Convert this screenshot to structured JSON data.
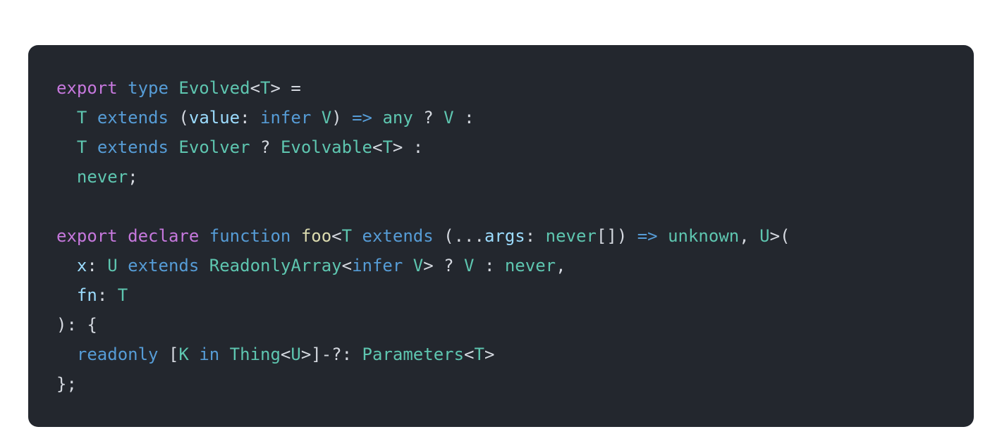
{
  "colors": {
    "background": "#23272e",
    "keyword_export": "#c678dd",
    "keyword_storage": "#c678dd",
    "keyword_type": "#569cd6",
    "type_name": "#5ec6b0",
    "param_name": "#9cdcfe",
    "fn_name": "#dcdcb0",
    "default_text": "#d5d9e0"
  },
  "code": {
    "l0": {
      "export": "export",
      "type": "type",
      "Evolved": "Evolved",
      "lt": "<",
      "T": "T",
      "gt": ">",
      "eq": " ="
    },
    "l1": {
      "indent": "  ",
      "T": "T",
      "extends": "extends",
      "paren_open": "(",
      "value": "value",
      "colon": ":",
      "infer": "infer",
      "V": "V",
      "paren_close": ")",
      "arrow": "=>",
      "any": "any",
      "q": "?",
      "V2": "V",
      "colon2": ":"
    },
    "l2": {
      "indent": "  ",
      "T": "T",
      "extends": "extends",
      "Evolver": "Evolver",
      "q": "?",
      "Evolvable": "Evolvable",
      "lt": "<",
      "T2": "T",
      "gt": ">",
      "colon": ":"
    },
    "l3": {
      "indent": "  ",
      "never": "never",
      "semi": ";"
    },
    "l5": {
      "export": "export",
      "declare": "declare",
      "function": "function",
      "foo": "foo",
      "lt": "<",
      "T": "T",
      "extends": "extends",
      "paren_open": "(",
      "ellipsis": "...",
      "args": "args",
      "colon": ":",
      "never": "never",
      "brackets": "[]",
      "paren_close": ")",
      "arrow": "=>",
      "unknown": "unknown",
      "comma": ",",
      "U": "U",
      "gt": ">",
      "paren_open2": "("
    },
    "l6": {
      "indent": "  ",
      "x": "x",
      "colon": ":",
      "U": "U",
      "extends": "extends",
      "ReadonlyArray": "ReadonlyArray",
      "lt": "<",
      "infer": "infer",
      "V": "V",
      "gt": ">",
      "q": "?",
      "V2": "V",
      "colon2": ":",
      "never": "never",
      "comma": ","
    },
    "l7": {
      "indent": "  ",
      "fn": "fn",
      "colon": ":",
      "T": "T"
    },
    "l8": {
      "paren_close": ")",
      "colon": ":",
      "brace_open": "{"
    },
    "l9": {
      "indent": "  ",
      "readonly": "readonly",
      "brk_open": "[",
      "K": "K",
      "in": "in",
      "Thing": "Thing",
      "lt": "<",
      "U": "U",
      "gt": ">",
      "brk_close": "]",
      "minus_q": "-?",
      "colon": ":",
      "Parameters": "Parameters",
      "lt2": "<",
      "T": "T",
      "gt2": ">"
    },
    "l10": {
      "brace_close": "}",
      "semi": ";"
    }
  }
}
